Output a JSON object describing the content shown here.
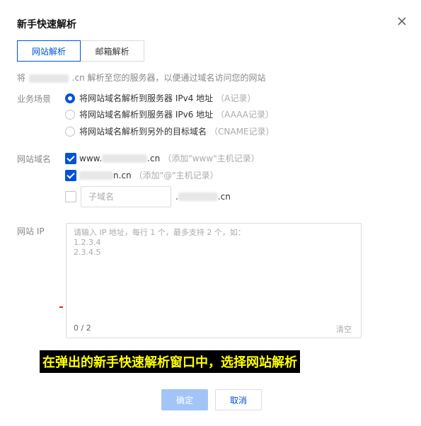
{
  "dialog": {
    "title": "新手快速解析"
  },
  "tabs": [
    {
      "label": "网站解析",
      "active": true
    },
    {
      "label": "邮箱解析",
      "active": false
    }
  ],
  "tip": {
    "prefix": "将",
    "suffix": ".cn 解析至您的服务器，以便通过域名访问您的网站"
  },
  "scenario": {
    "label": "业务场景",
    "options": [
      {
        "text": "将网站域名解析到服务器 IPv4 地址",
        "hint": "（A记录）",
        "checked": true
      },
      {
        "text": "将网站域名解析到服务器 IPv6 地址",
        "hint": "（AAAA记录）",
        "checked": false
      },
      {
        "text": "将网站域名解析到另外的目标域名",
        "hint": "（CNAME记录）",
        "checked": false
      }
    ]
  },
  "domain": {
    "label": "网站域名",
    "www": {
      "prefix": "www.",
      "suffix": ".cn",
      "hint": "（添加\"www\"主机记录）",
      "checked": true
    },
    "root": {
      "suffix": "n.cn",
      "hint": "（添加\"@\"主机记录）",
      "checked": true
    },
    "custom": {
      "placeholder": "子域名",
      "dot": ".",
      "suffix": ".cn",
      "checked": false
    }
  },
  "ip": {
    "label": "网站 IP",
    "placeholder": "请输入 IP 地址，每行 1 个，最多支持 2 个，如：\n1.2.3.4\n2.3.4.5",
    "counter": "0 / 2",
    "clear": "清空"
  },
  "caption": "在弹出的新手快速解析窗口中，选择网站解析",
  "buttons": {
    "ok": "确定",
    "cancel": "取消"
  },
  "colors": {
    "primary": "#0052d9",
    "primary_disabled": "#a3c4f7",
    "caption_text": "#ffff00"
  }
}
